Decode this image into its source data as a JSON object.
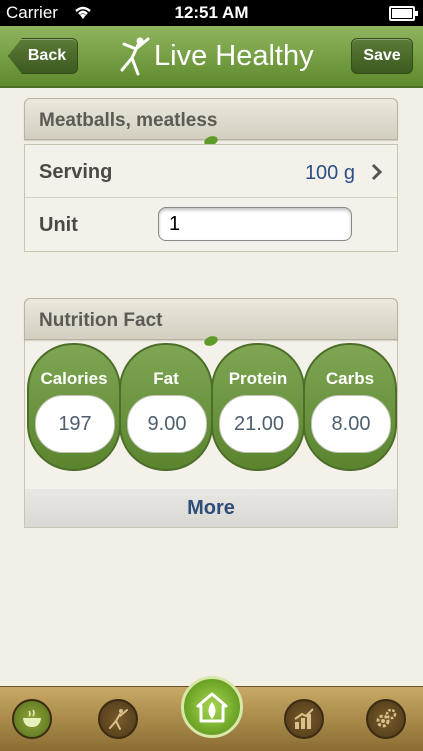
{
  "status_bar": {
    "carrier": "Carrier",
    "time": "12:51 AM"
  },
  "nav": {
    "back_label": "Back",
    "title": "Live Healthy",
    "save_label": "Save"
  },
  "food": {
    "name": "Meatballs, meatless",
    "serving_label": "Serving",
    "serving_value": "100 g",
    "unit_label": "Unit",
    "unit_value": "1"
  },
  "nutrition": {
    "title": "Nutrition Fact",
    "items": [
      {
        "label": "Calories",
        "value": "197"
      },
      {
        "label": "Fat",
        "value": "9.00"
      },
      {
        "label": "Protein",
        "value": "21.00"
      },
      {
        "label": "Carbs",
        "value": "8.00"
      }
    ],
    "more_label": "More"
  },
  "tabs": [
    "bowl-icon",
    "yoga-icon",
    "home-icon",
    "chart-icon",
    "settings-icon"
  ]
}
